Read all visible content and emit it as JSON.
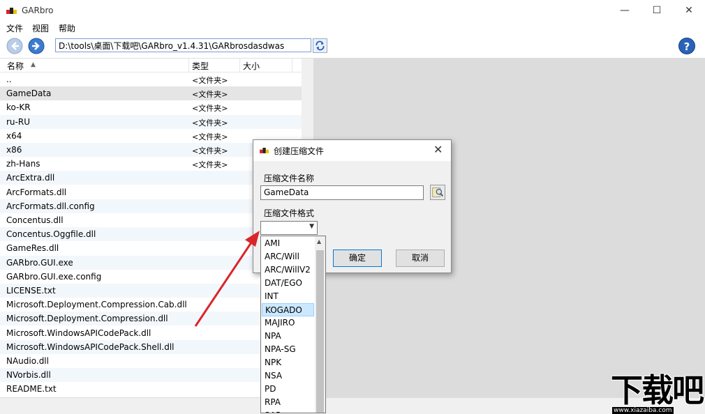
{
  "window": {
    "title": "GARbro",
    "minimize": "—",
    "maximize": "☐",
    "close": "✕"
  },
  "menu": [
    "文件",
    "视图",
    "帮助"
  ],
  "toolbar": {
    "path": "D:\\tools\\桌面\\下载吧\\GARbro_v1.4.31\\GARbrosdasdwas",
    "help": "?"
  },
  "columns": {
    "name": "名称",
    "type": "类型",
    "size": "大小"
  },
  "files": [
    {
      "name": "..",
      "type": "<文件夹>"
    },
    {
      "name": "GameData",
      "type": "<文件夹>"
    },
    {
      "name": "ko-KR",
      "type": "<文件夹>"
    },
    {
      "name": "ru-RU",
      "type": "<文件夹>"
    },
    {
      "name": "x64",
      "type": "<文件夹>"
    },
    {
      "name": "x86",
      "type": "<文件夹>"
    },
    {
      "name": "zh-Hans",
      "type": "<文件夹>"
    },
    {
      "name": "ArcExtra.dll",
      "type": ""
    },
    {
      "name": "ArcFormats.dll",
      "type": ""
    },
    {
      "name": "ArcFormats.dll.config",
      "type": ""
    },
    {
      "name": "Concentus.dll",
      "type": ""
    },
    {
      "name": "Concentus.Oggfile.dll",
      "type": ""
    },
    {
      "name": "GameRes.dll",
      "type": ""
    },
    {
      "name": "GARbro.GUI.exe",
      "type": ""
    },
    {
      "name": "GARbro.GUI.exe.config",
      "type": ""
    },
    {
      "name": "LICENSE.txt",
      "type": ""
    },
    {
      "name": "Microsoft.Deployment.Compression.Cab.dll",
      "type": ""
    },
    {
      "name": "Microsoft.Deployment.Compression.dll",
      "type": ""
    },
    {
      "name": "Microsoft.WindowsAPICodePack.dll",
      "type": ""
    },
    {
      "name": "Microsoft.WindowsAPICodePack.Shell.dll",
      "type": ""
    },
    {
      "name": "NAudio.dll",
      "type": ""
    },
    {
      "name": "NVorbis.dll",
      "type": ""
    },
    {
      "name": "README.txt",
      "type": ""
    }
  ],
  "dialog": {
    "title": "创建压缩文件",
    "name_label": "压缩文件名称",
    "name_value": "GameData",
    "format_label": "压缩文件格式",
    "ok": "确定",
    "cancel": "取消"
  },
  "formats": [
    "AMI",
    "ARC/Will",
    "ARC/WillV2",
    "DAT/EGO",
    "INT",
    "KOGADO",
    "MAJIRO",
    "NPA",
    "NPA-SG",
    "NPK",
    "NSA",
    "PD",
    "RPA",
    "SAR"
  ],
  "highlighted_format": "KOGADO",
  "watermark": {
    "text": "下载吧",
    "url": "www.xiazaiba.com"
  },
  "colors": {
    "accent": "#0078d7",
    "arrow": "#d9262a"
  }
}
